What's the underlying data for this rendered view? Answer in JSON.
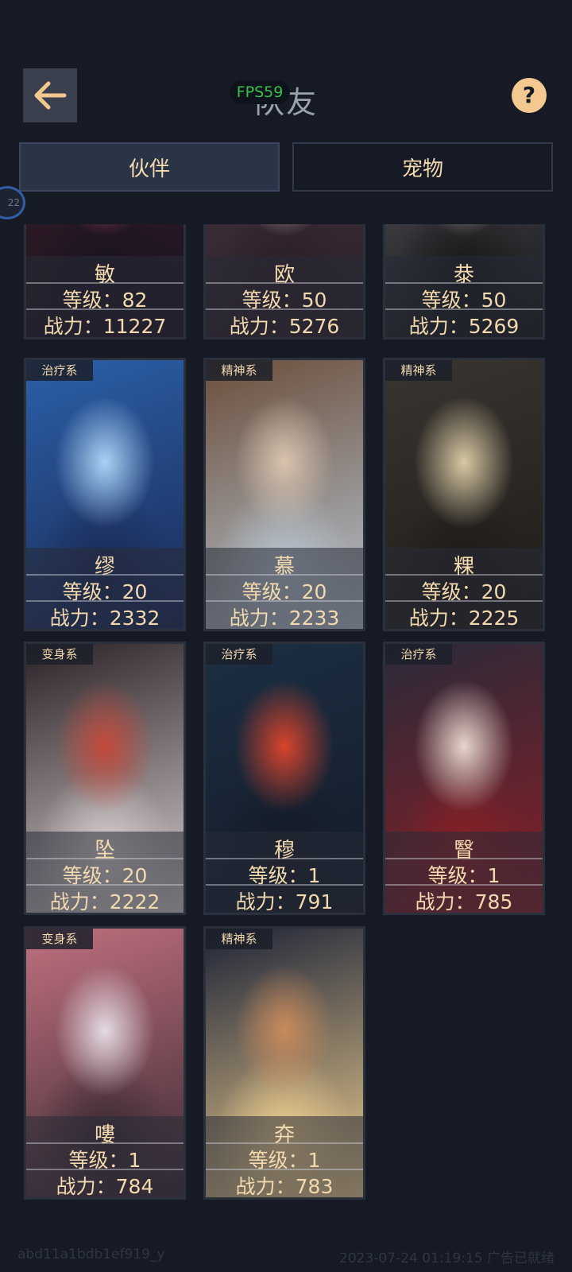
{
  "header": {
    "title": "队友",
    "fps": "FPS59",
    "back_icon": "arrow-left-icon",
    "help_icon": "question-icon",
    "help_label": "?"
  },
  "tabs": [
    {
      "label": "伙伴",
      "active": true
    },
    {
      "label": "宠物",
      "active": false
    }
  ],
  "side_badge": "22",
  "companions": [
    {
      "tag": "",
      "name": "敏",
      "level": "等级：82",
      "power": "战力：11227",
      "art": [
        "#3a1d2a",
        "#c94f7a",
        "#1a1420"
      ]
    },
    {
      "tag": "",
      "name": "欧",
      "level": "等级：50",
      "power": "战力：5276",
      "art": [
        "#4a3a44",
        "#e8c8d0",
        "#2a1e26"
      ]
    },
    {
      "tag": "",
      "name": "㳟",
      "level": "等级：50",
      "power": "战力：5269",
      "art": [
        "#5a5a62",
        "#c9c4c0",
        "#161618"
      ]
    },
    {
      "tag": "治疗系",
      "name": "缪",
      "level": "等级：20",
      "power": "战力：2332",
      "art": [
        "#2b5fa8",
        "#a9d3f5",
        "#1b2a55"
      ]
    },
    {
      "tag": "精神系",
      "name": "慕",
      "level": "等级：20",
      "power": "战力：2233",
      "art": [
        "#6b4e3b",
        "#d9c3ae",
        "#b8c6d2"
      ]
    },
    {
      "tag": "精神系",
      "name": "粿",
      "level": "等级：20",
      "power": "战力：2225",
      "art": [
        "#3a3530",
        "#d8c9a4",
        "#1e1b18"
      ]
    },
    {
      "tag": "变身系",
      "name": "坠",
      "level": "等级：20",
      "power": "战力：2222",
      "art": [
        "#2a2226",
        "#c44a3c",
        "#d9d0d0"
      ]
    },
    {
      "tag": "治疗系",
      "name": "穆",
      "level": "等级：1",
      "power": "战力：791",
      "art": [
        "#1c2f44",
        "#d9442c",
        "#141a26"
      ]
    },
    {
      "tag": "治疗系",
      "name": "瞖",
      "level": "等级：1",
      "power": "战力：785",
      "art": [
        "#2a2a3a",
        "#e8d6cc",
        "#8a1f25"
      ]
    },
    {
      "tag": "变身系",
      "name": "嘍",
      "level": "等级：1",
      "power": "战力：784",
      "art": [
        "#c0707e",
        "#e4dbe4",
        "#3a2a32"
      ]
    },
    {
      "tag": "精神系",
      "name": "㚏",
      "level": "等级：1",
      "power": "战力：783",
      "art": [
        "#1e2438",
        "#c98a5c",
        "#f0d090"
      ]
    }
  ],
  "footer": {
    "left": "abd11a1bdb1ef919_y",
    "right": "2023-07-24 01:19:15 广告已就绪"
  }
}
